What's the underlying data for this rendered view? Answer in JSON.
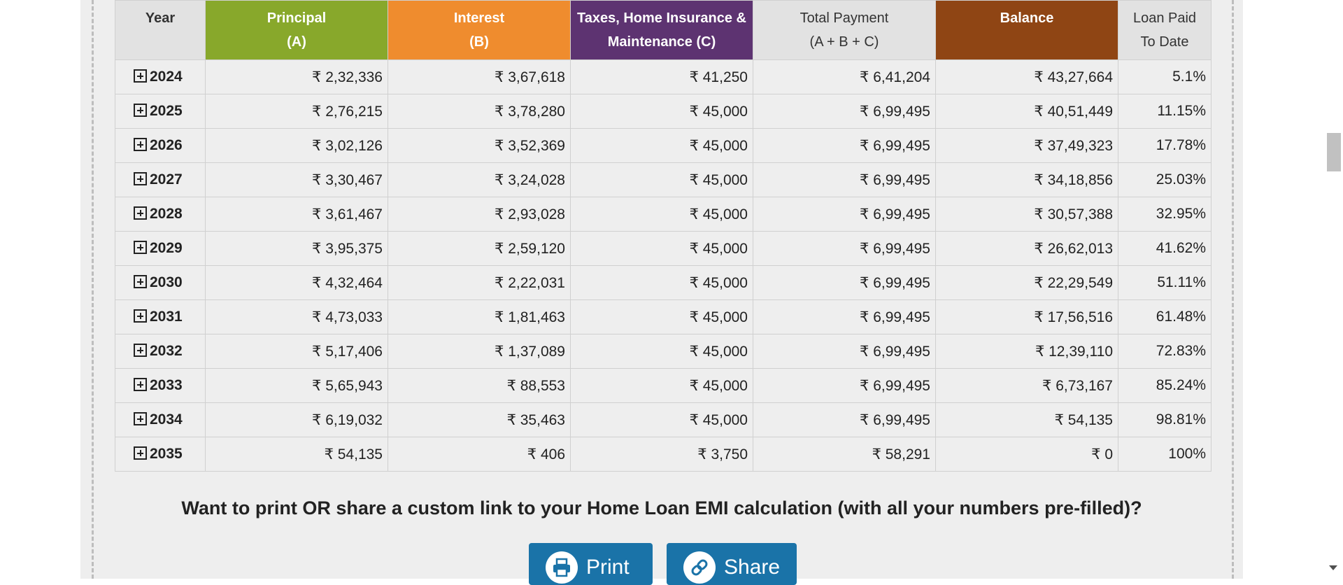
{
  "table": {
    "headers": {
      "year": "Year",
      "principal_line1": "Principal",
      "principal_line2": "(A)",
      "interest_line1": "Interest",
      "interest_line2": "(B)",
      "taxes_line1": "Taxes, Home Insurance &",
      "taxes_line2": "Maintenance (C)",
      "total_line1": "Total Payment",
      "total_line2": "(A + B + C)",
      "balance": "Balance",
      "paid_line1": "Loan Paid",
      "paid_line2": "To Date"
    },
    "header_colors": {
      "principal": "#88a82b",
      "interest": "#ef8c2e",
      "taxes": "#5d3371",
      "balance": "#8f4514",
      "neutral": "#e2e2e2"
    },
    "row_icon": "expand-plus-icon",
    "rows": [
      {
        "year": "2024",
        "principal": "₹ 2,32,336",
        "interest": "₹ 3,67,618",
        "taxes": "₹ 41,250",
        "total": "₹ 6,41,204",
        "balance": "₹ 43,27,664",
        "paid": "5.1%"
      },
      {
        "year": "2025",
        "principal": "₹ 2,76,215",
        "interest": "₹ 3,78,280",
        "taxes": "₹ 45,000",
        "total": "₹ 6,99,495",
        "balance": "₹ 40,51,449",
        "paid": "11.15%"
      },
      {
        "year": "2026",
        "principal": "₹ 3,02,126",
        "interest": "₹ 3,52,369",
        "taxes": "₹ 45,000",
        "total": "₹ 6,99,495",
        "balance": "₹ 37,49,323",
        "paid": "17.78%"
      },
      {
        "year": "2027",
        "principal": "₹ 3,30,467",
        "interest": "₹ 3,24,028",
        "taxes": "₹ 45,000",
        "total": "₹ 6,99,495",
        "balance": "₹ 34,18,856",
        "paid": "25.03%"
      },
      {
        "year": "2028",
        "principal": "₹ 3,61,467",
        "interest": "₹ 2,93,028",
        "taxes": "₹ 45,000",
        "total": "₹ 6,99,495",
        "balance": "₹ 30,57,388",
        "paid": "32.95%"
      },
      {
        "year": "2029",
        "principal": "₹ 3,95,375",
        "interest": "₹ 2,59,120",
        "taxes": "₹ 45,000",
        "total": "₹ 6,99,495",
        "balance": "₹ 26,62,013",
        "paid": "41.62%"
      },
      {
        "year": "2030",
        "principal": "₹ 4,32,464",
        "interest": "₹ 2,22,031",
        "taxes": "₹ 45,000",
        "total": "₹ 6,99,495",
        "balance": "₹ 22,29,549",
        "paid": "51.11%"
      },
      {
        "year": "2031",
        "principal": "₹ 4,73,033",
        "interest": "₹ 1,81,463",
        "taxes": "₹ 45,000",
        "total": "₹ 6,99,495",
        "balance": "₹ 17,56,516",
        "paid": "61.48%"
      },
      {
        "year": "2032",
        "principal": "₹ 5,17,406",
        "interest": "₹ 1,37,089",
        "taxes": "₹ 45,000",
        "total": "₹ 6,99,495",
        "balance": "₹ 12,39,110",
        "paid": "72.83%"
      },
      {
        "year": "2033",
        "principal": "₹ 5,65,943",
        "interest": "₹ 88,553",
        "taxes": "₹ 45,000",
        "total": "₹ 6,99,495",
        "balance": "₹ 6,73,167",
        "paid": "85.24%"
      },
      {
        "year": "2034",
        "principal": "₹ 6,19,032",
        "interest": "₹ 35,463",
        "taxes": "₹ 45,000",
        "total": "₹ 6,99,495",
        "balance": "₹ 54,135",
        "paid": "98.81%"
      },
      {
        "year": "2035",
        "principal": "₹ 54,135",
        "interest": "₹ 406",
        "taxes": "₹ 3,750",
        "total": "₹ 58,291",
        "balance": "₹ 0",
        "paid": "100%"
      }
    ]
  },
  "cta": {
    "text": "Want to print OR share a custom link to your Home Loan EMI calculation (with all your numbers pre-filled)?"
  },
  "buttons": {
    "print_label": "Print",
    "print_icon": "printer-icon",
    "share_label": "Share",
    "share_icon": "link-icon",
    "color": "#1a73a8"
  }
}
